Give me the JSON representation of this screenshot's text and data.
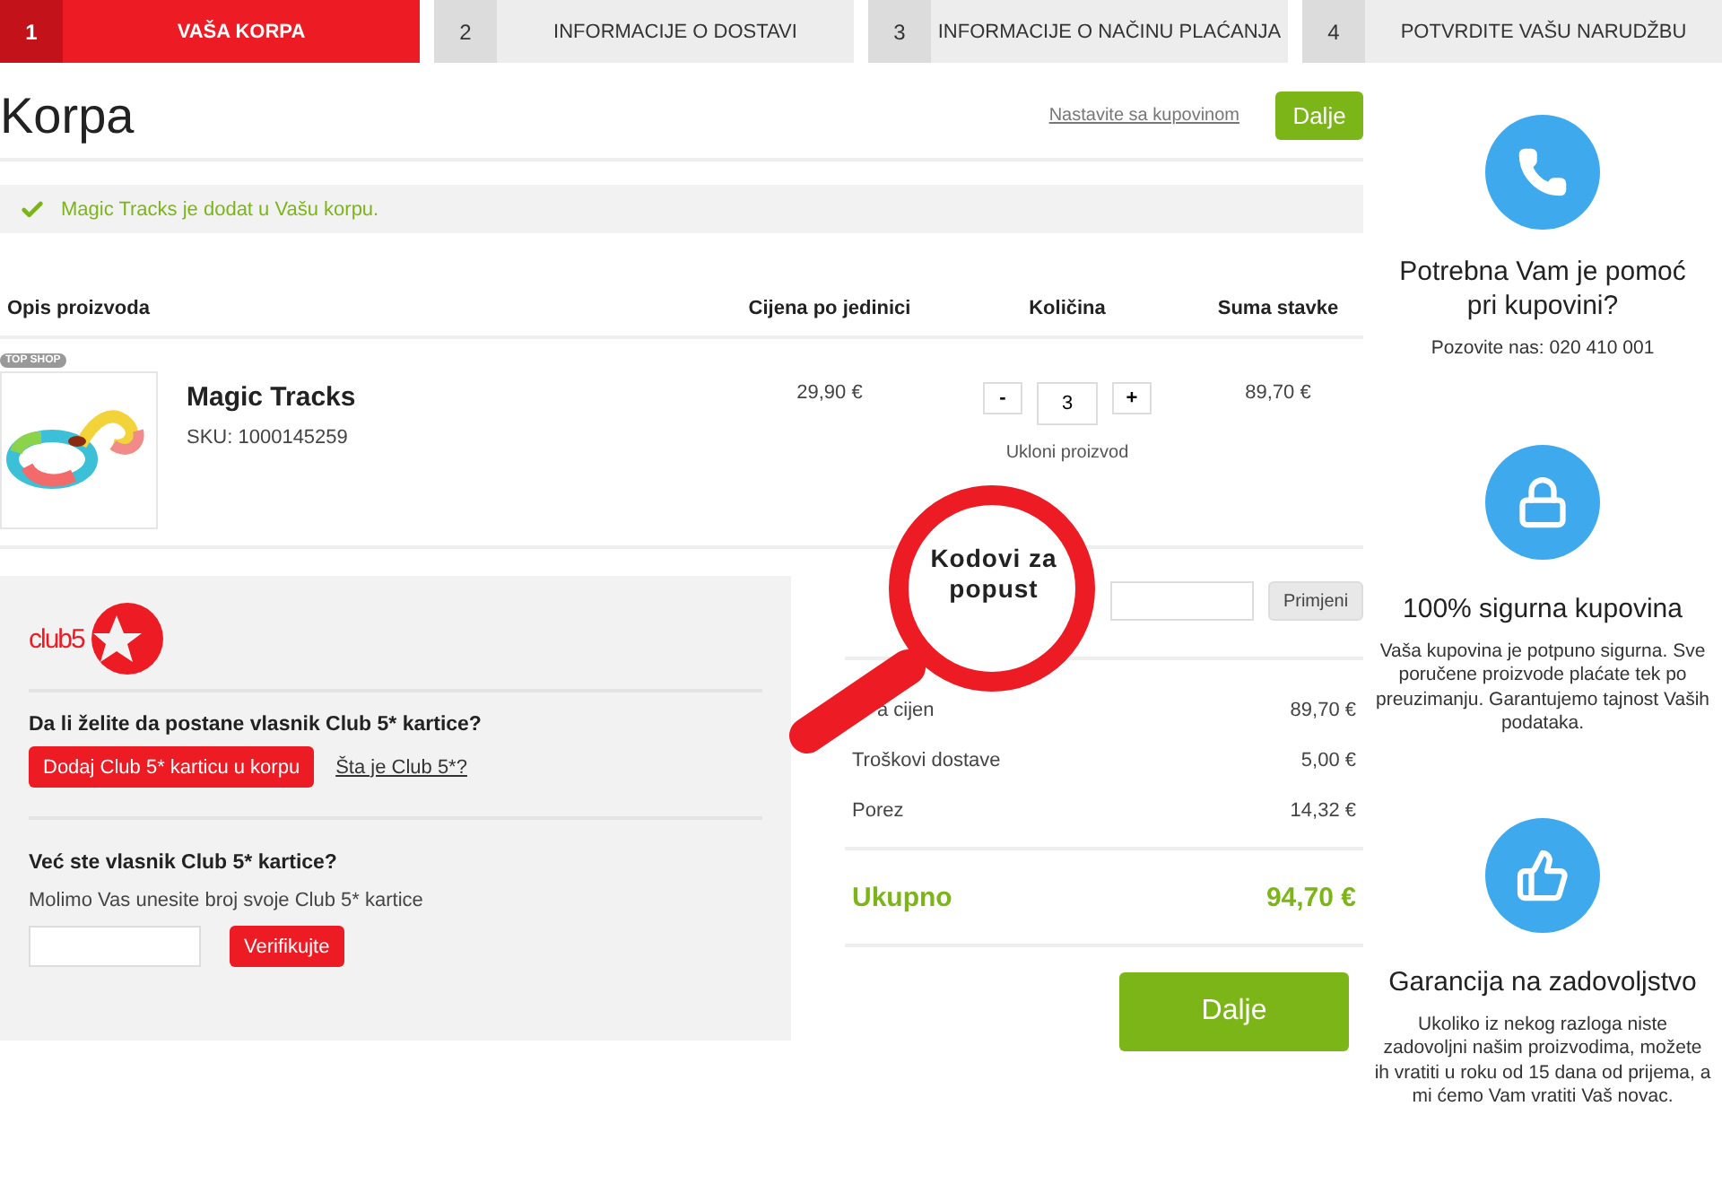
{
  "steps": [
    {
      "number": "1",
      "label": "VAŠA KORPA",
      "selected": true
    },
    {
      "number": "2",
      "label": "INFORMACIJE O DOSTAVI",
      "selected": false
    },
    {
      "number": "3",
      "label": "INFORMACIJE O NAČINU PLAĆANJA",
      "selected": false
    },
    {
      "number": "4",
      "label": "POTVRDITE VAŠU NARUDŽBU",
      "selected": false
    }
  ],
  "header": {
    "title": "Korpa",
    "continue_link": "Nastavite sa kupovinom",
    "next_button": "Dalje"
  },
  "notice": {
    "text": "Magic Tracks je dodat u Vašu korpu."
  },
  "table": {
    "columns": [
      "Opis proizvoda",
      "Cijena po jedinici",
      "Količina",
      "Suma stavke"
    ],
    "rows": [
      {
        "badge": "TOP SHOP",
        "name": "Magic Tracks",
        "sku": "SKU: 1000145259",
        "unit_price": "29,90 €",
        "minus": "-",
        "quantity": "3",
        "plus": "+",
        "remove": "Ukloni proizvod",
        "total": "89,70 €"
      }
    ]
  },
  "club": {
    "logo_text": "club5",
    "question": "Da li želite da postane vlasnik Club 5* kartice?",
    "add_button": "Dodaj Club 5* karticu u korpu",
    "info_link": "Šta je Club 5*?",
    "member_question": "Već ste vlasnik Club 5* kartice?",
    "member_hint": "Molimo Vas unesite broj svoje Club 5* kartice",
    "verify_button": "Verifikujte"
  },
  "coupon": {
    "callout": "Kodovi za popust",
    "button": "Primjeni"
  },
  "summary": {
    "rows": [
      {
        "label": "a cijen",
        "value": "89,70 €"
      },
      {
        "label": "Troškovi dostave",
        "value": "5,00 €"
      },
      {
        "label": "Porez",
        "value": "14,32 €"
      }
    ],
    "total_label": "Ukupno",
    "total_value": "94,70 €",
    "checkout_button": "Dalje"
  },
  "sidebar": [
    {
      "kind": "phone",
      "title": "Potrebna Vam je pomoć pri kupovini?",
      "text": "Pozovite nas: 020 410 001"
    },
    {
      "kind": "lock",
      "title": "100% sigurna kupovina",
      "text": "Vaša kupovina je potpuno sigurna. Sve poručene proizvode plaćate tek po preuzimanju. Garantujemo tajnost Vaših podataka."
    },
    {
      "kind": "thumb",
      "title": "Garancija na zadovoljstvo",
      "text": "Ukoliko iz nekog razloga niste zadovoljni našim proizvodima, možete ih vratiti u roku od 15 dana od prijema, a mi ćemo Vam vratiti Vaš novac."
    }
  ]
}
